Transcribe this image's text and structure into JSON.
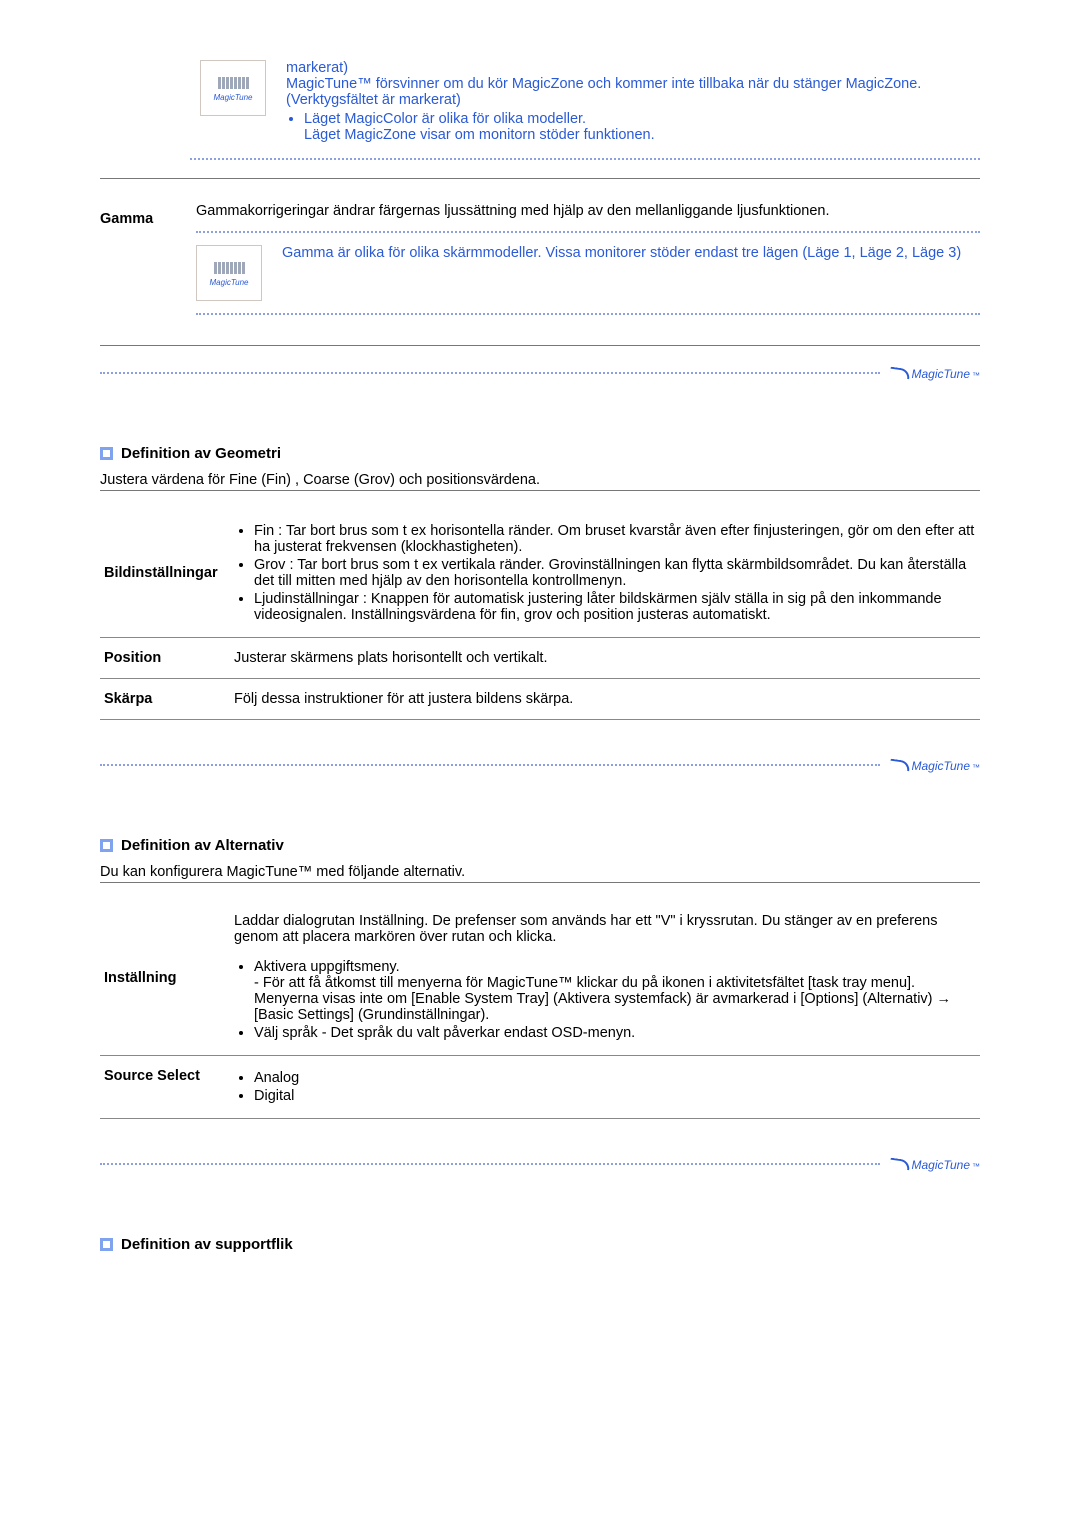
{
  "magiczone": {
    "note1a": "markerat)",
    "note1b": "MagicTune™ försvinner om du kör MagicZone och kommer inte tillbaka när du stänger MagicZone. (Verktygsfältet är markerat)",
    "bullet1": "Läget MagicColor är olika för olika modeller.",
    "bullet1_sub": "Läget MagicZone visar om monitorn stöder funktionen."
  },
  "gamma": {
    "label": "Gamma",
    "intro": "Gammakorrigeringar ändrar färgernas ljussättning med hjälp av den mellanliggande ljusfunktionen.",
    "note": "Gamma är olika för olika skärmmodeller. Vissa monitorer stöder endast tre lägen (Läge 1, Läge 2, Läge 3)"
  },
  "geometry": {
    "title": "Definition av Geometri",
    "intro": "Justera värdena för Fine (Fin) , Coarse (Grov) och positionsvärdena.",
    "rows": [
      {
        "term": "Bildinställningar",
        "bullets": [
          "Fin : Tar bort brus som t ex horisontella ränder. Om bruset kvarstår även efter finjusteringen, gör om den efter att ha justerat frekvensen (klockhastigheten).",
          "Grov : Tar bort brus som t ex vertikala ränder. Grovinställningen kan flytta skärmbildsområdet. Du kan återställa det till mitten med hjälp av den horisontella kontrollmenyn.",
          "Ljudinställningar : Knappen för automatisk justering låter bildskärmen själv ställa in sig på den inkommande videosignalen. Inställningsvärdena för fin, grov och position justeras automatiskt."
        ]
      },
      {
        "term": "Position",
        "desc": "Justerar skärmens plats horisontellt och vertikalt."
      },
      {
        "term": "Skärpa",
        "desc": "Följ dessa instruktioner för att justera bildens skärpa."
      }
    ]
  },
  "alternativ": {
    "title": "Definition av Alternativ",
    "intro": "Du kan konfigurera MagicTune™ med följande alternativ.",
    "rows": [
      {
        "term": "Inställning",
        "lead": "Laddar dialogrutan Inställning. De prefenser som används har ett \"V\" i kryssrutan. Du stänger av en preferens genom att placera markören över rutan och klicka.",
        "bullets": [
          "Aktivera uppgiftsmeny.\n- För att få åtkomst till menyerna för MagicTune™ klickar du på ikonen i aktivitetsfältet [task tray menu]. Menyerna visas inte om [Enable System Tray] (Aktivera systemfack) är avmarkerad i [Options] (Alternativ) → [Basic Settings] (Grundinställningar).",
          "Välj språk - Det språk du valt påverkar endast OSD-menyn."
        ]
      },
      {
        "term": "Source Select",
        "bullets": [
          "Analog",
          "Digital"
        ]
      }
    ]
  },
  "support": {
    "title": "Definition av supportflik"
  },
  "brand": {
    "name": "MagicTune",
    "tm": "™"
  },
  "icon_labels": {
    "magictune": "MagicTune"
  }
}
